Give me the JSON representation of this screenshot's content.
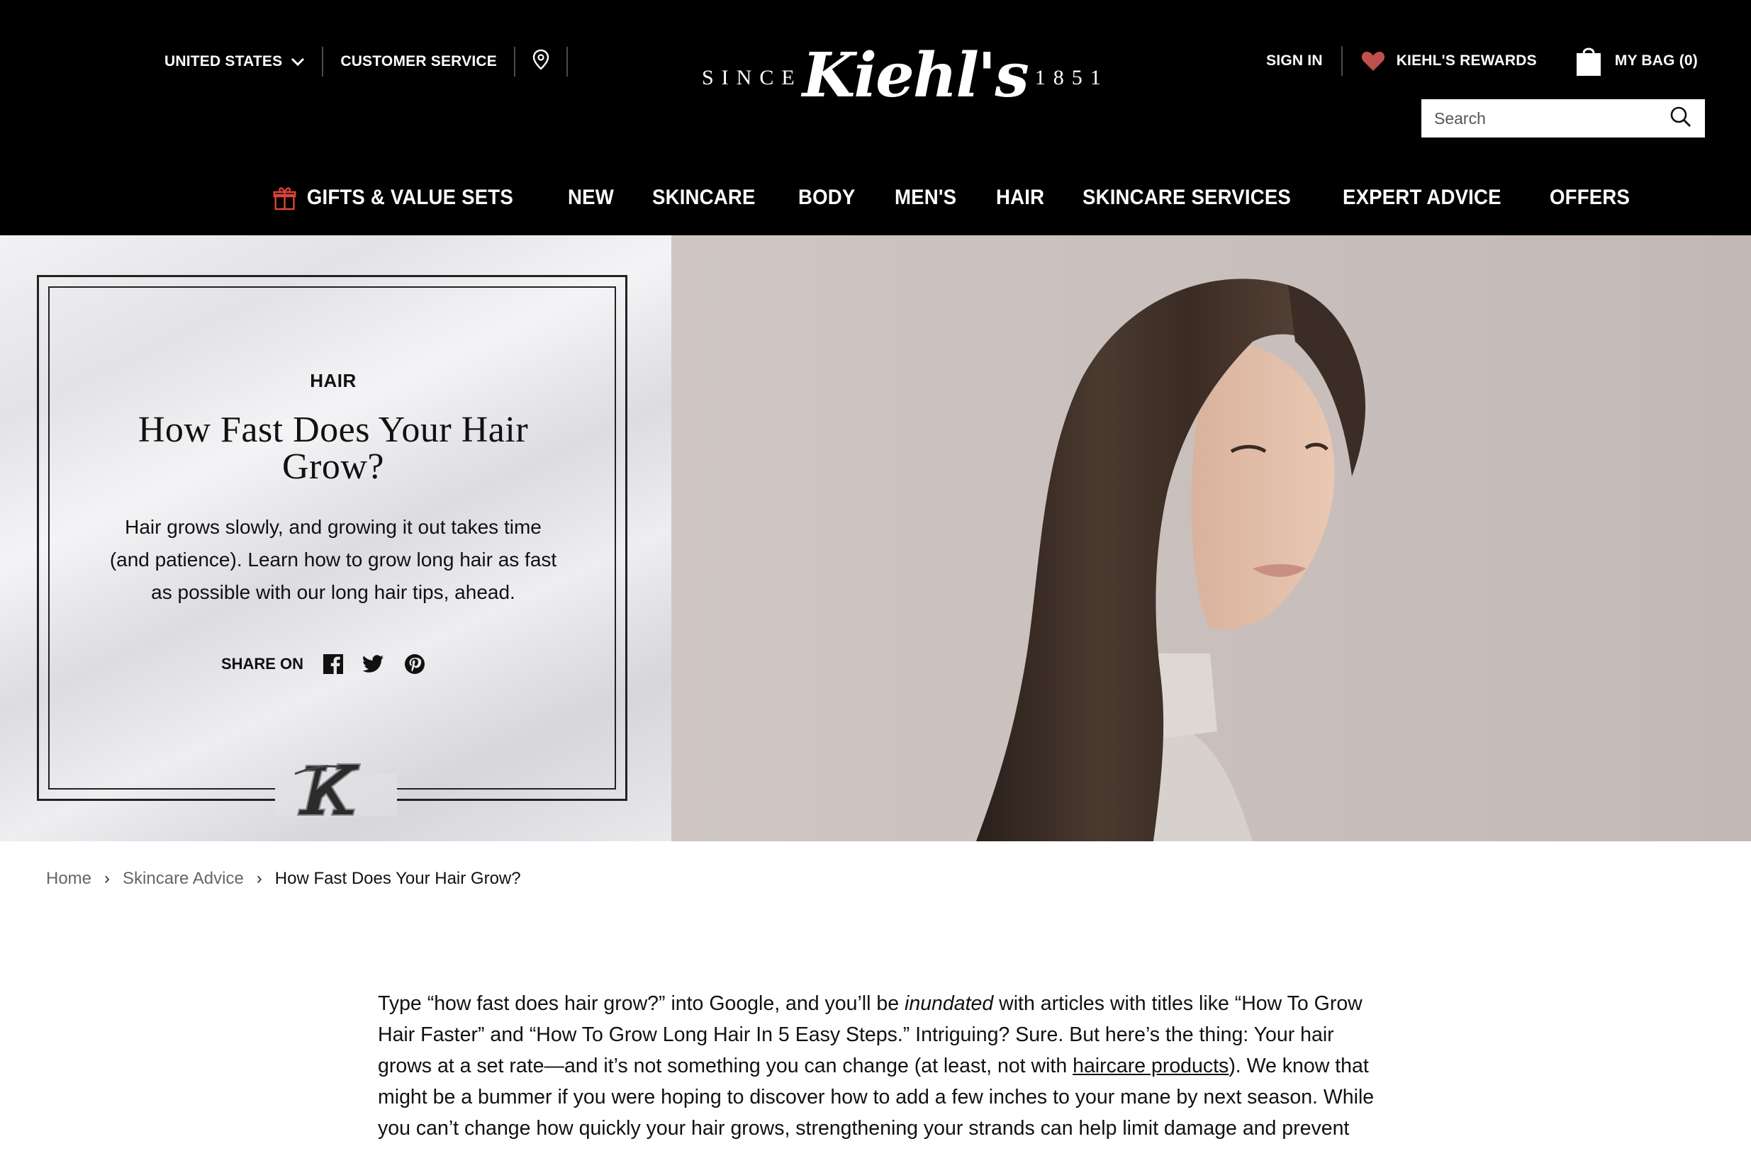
{
  "colors": {
    "header_bg": "#000000",
    "heart": "#c0504d",
    "gift": "#d9443a"
  },
  "header": {
    "country": "UNITED STATES",
    "customer_service": "CUSTOMER SERVICE",
    "logo": {
      "since": "SINCE",
      "brand": "Kiehl's",
      "year": "1851"
    },
    "sign_in": "SIGN IN",
    "rewards": "KIEHL'S REWARDS",
    "bag": "MY BAG (0)",
    "search_placeholder": "Search"
  },
  "nav": [
    "GIFTS & VALUE SETS",
    "NEW",
    "SKINCARE",
    "BODY",
    "MEN'S",
    "HAIR",
    "SKINCARE SERVICES",
    "EXPERT ADVICE",
    "OFFERS"
  ],
  "hero": {
    "category": "HAIR",
    "title": "How Fast Does Your Hair Grow?",
    "description": "Hair grows slowly, and growing it out takes time (and patience). Learn how to grow long hair as fast as possible with our long hair tips, ahead.",
    "share_label": "SHARE ON",
    "icons": [
      "facebook-icon",
      "twitter-icon",
      "pinterest-icon"
    ]
  },
  "breadcrumb": {
    "home": "Home",
    "section": "Skincare Advice",
    "current": "How Fast Does Your Hair Grow?"
  },
  "article": {
    "p1_a": "Type “how fast does hair grow?” into Google, and you’ll be ",
    "p1_em": "inundated",
    "p1_b": " with articles with titles like “How To Grow Hair Faster” and “How To Grow Long Hair In 5 Easy Steps.” Intriguing? Sure. But here’s the thing: Your hair grows at a set rate—and it’s not something you can change (at least, not with ",
    "p1_link": "haircare products",
    "p1_c": "). We know that might be a bummer if you were hoping to discover how to add a few inches to your mane by next season. While you can’t change how quickly your hair grows, strengthening your strands can help limit damage and prevent breakage,"
  }
}
